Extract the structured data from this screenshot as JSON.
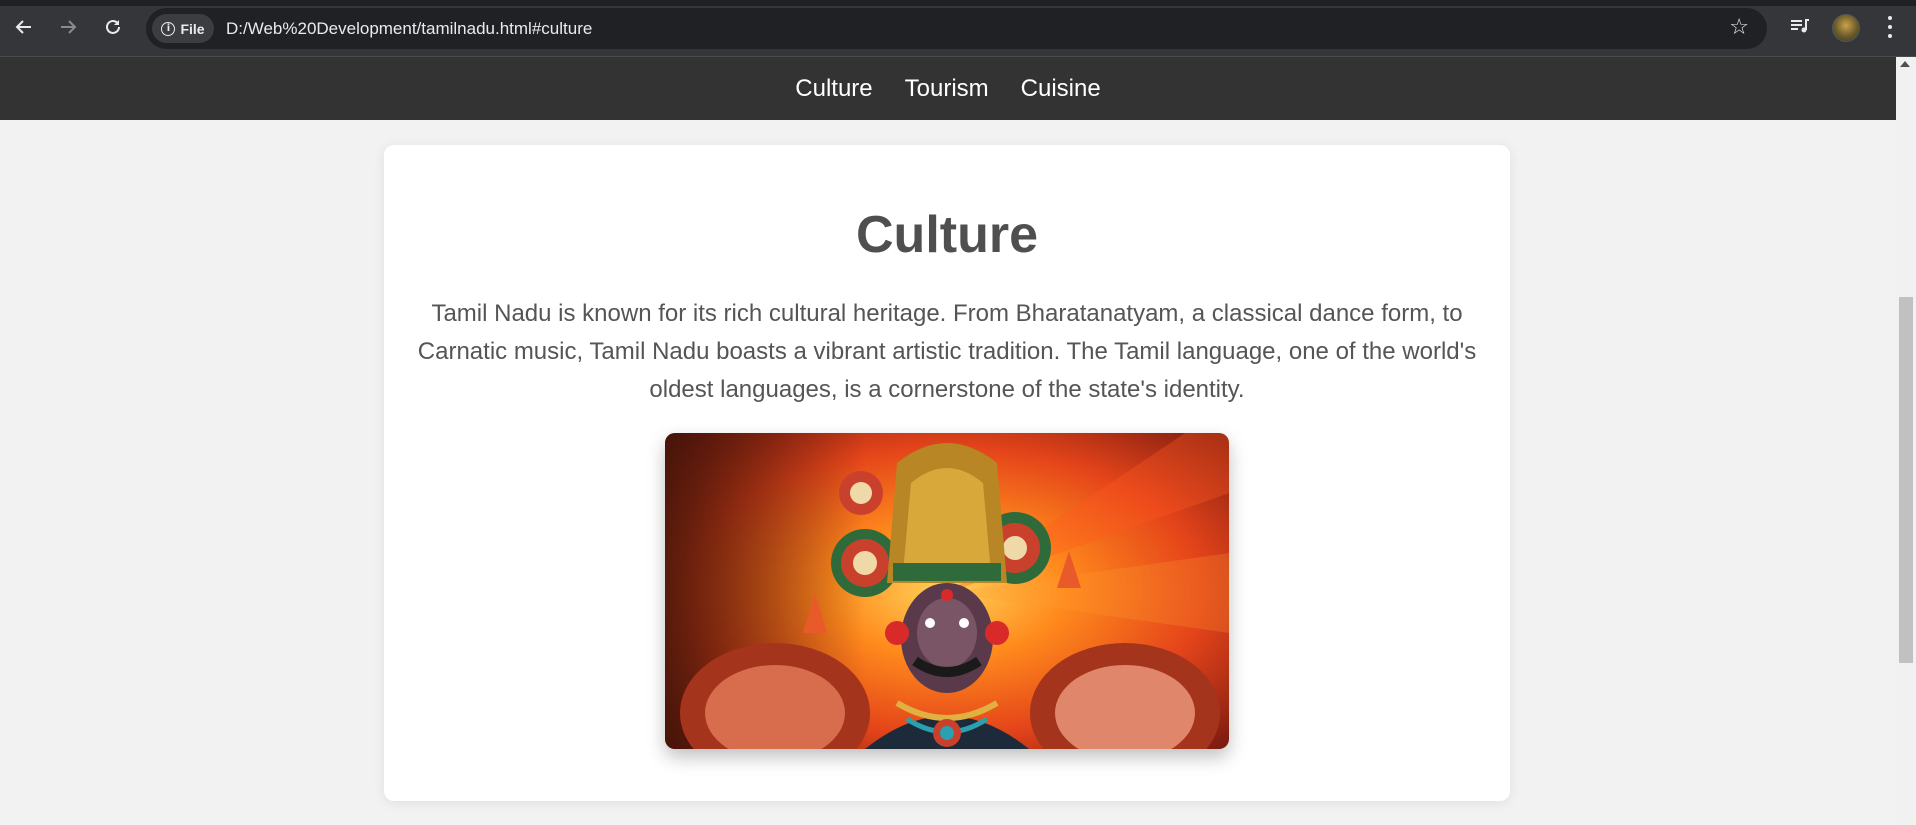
{
  "browser": {
    "back_icon": "arrow-left-icon",
    "forward_icon": "arrow-right-icon",
    "reload_icon": "reload-icon",
    "site_info_label": "File",
    "url": "D:/Web%20Development/tamilnadu.html#culture",
    "bookmark_icon": "star-icon",
    "media_icon": "queue-music-icon",
    "menu_icon": "kebab-menu-icon"
  },
  "nav": {
    "items": [
      {
        "label": "Culture"
      },
      {
        "label": "Tourism"
      },
      {
        "label": "Cuisine"
      }
    ],
    "background": "#333333"
  },
  "section": {
    "title": "Culture",
    "body": "Tamil Nadu is known for its rich cultural heritage. From Bharatanatyam, a classical dance form, to Carnatic music, Tamil Nadu boasts a vibrant artistic tradition. The Tamil language, one of the world's oldest languages, is a cornerstone of the state's identity."
  },
  "colors": {
    "page_bg": "#f2f2f2",
    "card_bg": "#ffffff",
    "heading": "#4f4f4f",
    "text": "#555555"
  }
}
